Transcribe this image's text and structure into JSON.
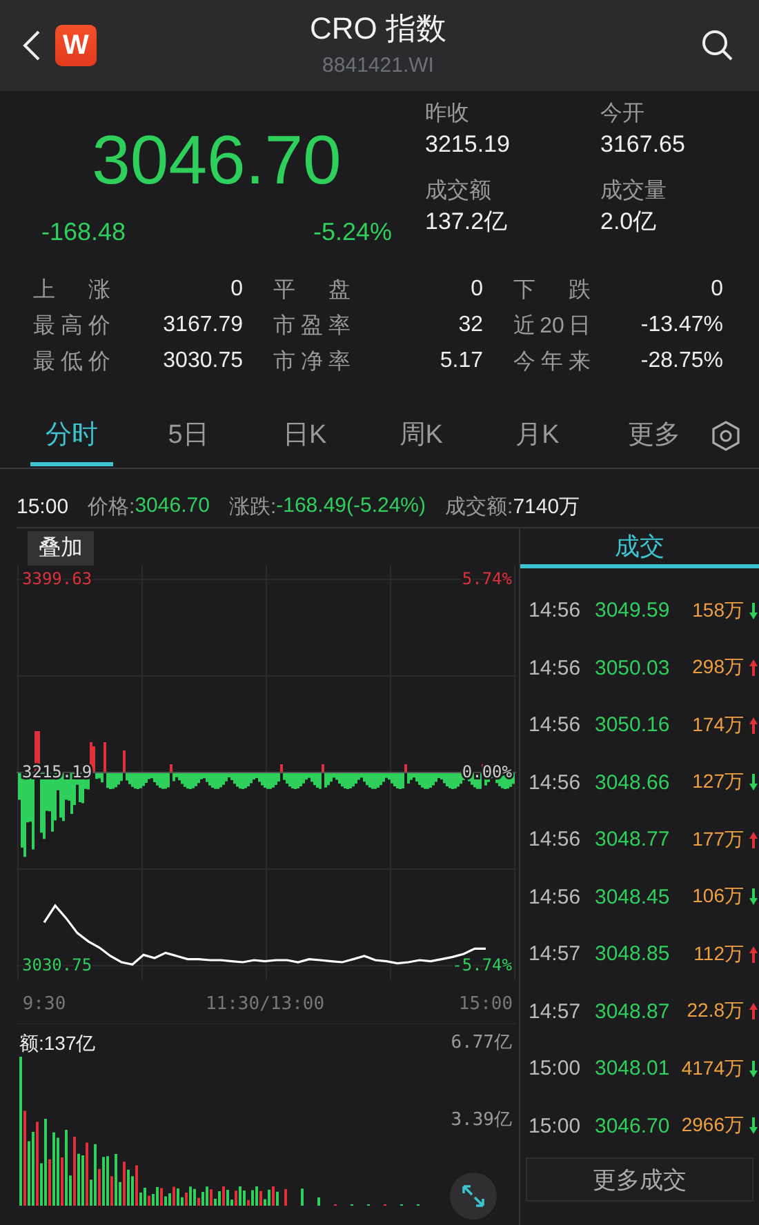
{
  "header": {
    "logo": "W",
    "title": "CRO 指数",
    "code": "8841421.WI"
  },
  "quote": {
    "price": "3046.70",
    "change": "-168.48",
    "change_pct": "-5.24%",
    "fields": [
      {
        "label": "昨收",
        "value": "3215.19"
      },
      {
        "label": "今开",
        "value": "3167.65"
      },
      {
        "label": "成交额",
        "value": "137.2亿"
      },
      {
        "label": "成交量",
        "value": "2.0亿"
      }
    ]
  },
  "stats": [
    [
      {
        "label": "上涨",
        "value": "0"
      },
      {
        "label": "平盘",
        "value": "0"
      },
      {
        "label": "下跌",
        "value": "0"
      }
    ],
    [
      {
        "label": "最高价",
        "value": "3167.79"
      },
      {
        "label": "市盈率",
        "value": "32"
      },
      {
        "label": "近20日",
        "value": "-13.47%"
      }
    ],
    [
      {
        "label": "最低价",
        "value": "3030.75"
      },
      {
        "label": "市净率",
        "value": "5.17"
      },
      {
        "label": "今年来",
        "value": "-28.75%"
      }
    ]
  ],
  "tabs": [
    {
      "label": "分时",
      "selected": true
    },
    {
      "label": "5日",
      "selected": false
    },
    {
      "label": "日K",
      "selected": false
    },
    {
      "label": "周K",
      "selected": false
    },
    {
      "label": "月K",
      "selected": false
    },
    {
      "label": "更多",
      "selected": false
    }
  ],
  "info": {
    "time": "15:00",
    "items": [
      {
        "label": "价格:",
        "value": "3046.70",
        "color": "#2fcf5c"
      },
      {
        "label": "涨跌:",
        "value": "-168.49(-5.24%)",
        "color": "#2fcf5c"
      },
      {
        "label": "成交额:",
        "value": "7140万",
        "color": "#e8e8e8"
      }
    ]
  },
  "chart": {
    "overlay_button": "叠加",
    "chart_data": {
      "type": "line",
      "categories": [
        "9:30",
        null,
        null,
        null,
        null,
        null,
        null,
        null,
        null,
        null,
        null,
        null,
        null,
        null,
        null,
        null,
        null,
        null,
        null,
        null,
        "11:30/13:00",
        null,
        null,
        null,
        null,
        null,
        null,
        null,
        null,
        null,
        null,
        null,
        null,
        null,
        null,
        null,
        null,
        null,
        null,
        null,
        "15:00"
      ],
      "ylim": [
        3030.75,
        3399.63
      ],
      "yticks": [
        {
          "value": 3399.63,
          "label": "3399.63"
        },
        {
          "value": 3215.19,
          "label": "3215.19"
        },
        {
          "value": 3030.75,
          "label": "3030.75"
        }
      ],
      "series": [
        {
          "color": "#ffffff",
          "values": [
            3072,
            3088,
            3076,
            3062,
            3054,
            3048,
            3040,
            3034,
            3032,
            3041,
            3038,
            3043,
            3040,
            3037,
            3037,
            3036,
            3036,
            3035,
            3034,
            3036,
            3035,
            3036,
            3036,
            3034,
            3037,
            3036,
            3035,
            3034,
            3037,
            3040,
            3036,
            3035,
            3033,
            3034,
            3036,
            3035,
            3037,
            3039,
            3042,
            3047,
            3047
          ]
        }
      ]
    },
    "right_labels": [
      "5.74%",
      "0.00%",
      "-5.74%"
    ]
  },
  "volume": {
    "label": "额:137亿",
    "axis_labels": [
      "6.77亿",
      "3.39亿"
    ]
  },
  "trades": {
    "title": "成交",
    "rows": [
      {
        "time": "14:56",
        "price": "3049.59",
        "volume": "158万",
        "kind": "down"
      },
      {
        "time": "14:56",
        "price": "3050.03",
        "volume": "298万",
        "kind": "up"
      },
      {
        "time": "14:56",
        "price": "3050.16",
        "volume": "174万",
        "kind": "up"
      },
      {
        "time": "14:56",
        "price": "3048.66",
        "volume": "127万",
        "kind": "down"
      },
      {
        "time": "14:56",
        "price": "3048.77",
        "volume": "177万",
        "kind": "up"
      },
      {
        "time": "14:56",
        "price": "3048.45",
        "volume": "106万",
        "kind": "down"
      },
      {
        "time": "14:57",
        "price": "3048.85",
        "volume": "112万",
        "kind": "up"
      },
      {
        "time": "14:57",
        "price": "3048.87",
        "volume": "22.8万",
        "kind": "up"
      },
      {
        "time": "15:00",
        "price": "3048.01",
        "volume": "4174万",
        "kind": "down"
      },
      {
        "time": "15:00",
        "price": "3046.70",
        "volume": "2966万",
        "kind": "down"
      }
    ],
    "more_button": "更多成交"
  }
}
